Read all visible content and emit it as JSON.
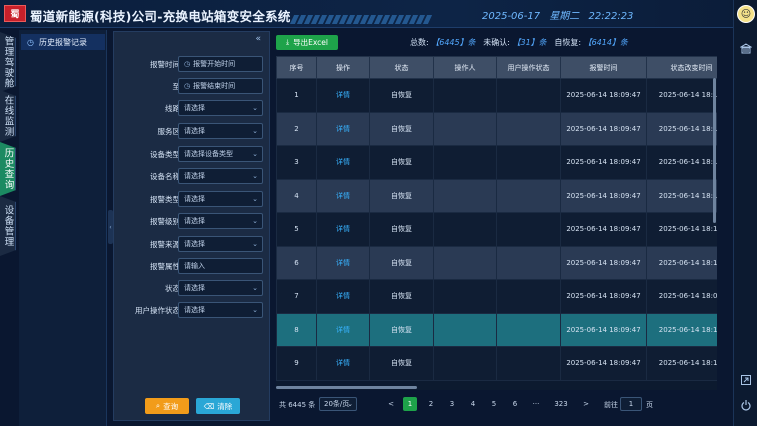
{
  "header": {
    "logo_text": "蜀",
    "title": "蜀道新能源(科技)公司-充换电站箱变安全系统",
    "date": "2025-06-17",
    "weekday": "星期二",
    "time": "22:22:23"
  },
  "vnav": {
    "items": [
      {
        "label": "管理驾驶舱"
      },
      {
        "label": "在线监测"
      },
      {
        "label": "历史查询"
      },
      {
        "label": "设备管理"
      }
    ]
  },
  "submenu": {
    "item": "历史报警记录"
  },
  "filter": {
    "collapse_icon": "«",
    "rows": [
      {
        "label": "报警时间",
        "value": "报警开始时间",
        "kind": "date"
      },
      {
        "label": "至",
        "value": "报警结束时间",
        "kind": "date"
      },
      {
        "label": "线路",
        "value": "请选择",
        "kind": "select"
      },
      {
        "label": "服务区",
        "value": "请选择",
        "kind": "select"
      },
      {
        "label": "设备类型",
        "value": "请选择设备类型",
        "kind": "select"
      },
      {
        "label": "设备名称",
        "value": "请选择",
        "kind": "select"
      },
      {
        "label": "报警类型",
        "value": "请选择",
        "kind": "select"
      },
      {
        "label": "报警级别",
        "value": "请选择",
        "kind": "select"
      },
      {
        "label": "报警来源",
        "value": "请选择",
        "kind": "select"
      },
      {
        "label": "报警属性",
        "value": "请输入",
        "kind": "text"
      },
      {
        "label": "状态",
        "value": "请选择",
        "kind": "select"
      },
      {
        "label": "用户操作状态",
        "value": "请选择",
        "kind": "select"
      }
    ],
    "query_label": "查询",
    "clear_label": "清除"
  },
  "toolbar": {
    "export_label": "导出Excel",
    "total_label": "总数:",
    "total_value": "【6445】条",
    "unconfirmed_label": "未确认:",
    "unconfirmed_value": "【31】条",
    "selfrecover_label": "自恢复:",
    "selfrecover_value": "【6414】条"
  },
  "table": {
    "columns": [
      "序号",
      "操作",
      "状态",
      "操作人",
      "用户操作状态",
      "报警时间",
      "状态改变时间"
    ],
    "rows": [
      {
        "no": "1",
        "op": "详情",
        "status": "自恢复",
        "operator": "",
        "user_status": "",
        "alarm_time": "2025-06-14 18:09:47",
        "change_time": "2025-06-14 18:10:"
      },
      {
        "no": "2",
        "op": "详情",
        "status": "自恢复",
        "operator": "",
        "user_status": "",
        "alarm_time": "2025-06-14 18:09:47",
        "change_time": "2025-06-14 18:10:"
      },
      {
        "no": "3",
        "op": "详情",
        "status": "自恢复",
        "operator": "",
        "user_status": "",
        "alarm_time": "2025-06-14 18:09:47",
        "change_time": "2025-06-14 18:11:"
      },
      {
        "no": "4",
        "op": "详情",
        "status": "自恢复",
        "operator": "",
        "user_status": "",
        "alarm_time": "2025-06-14 18:09:47",
        "change_time": "2025-06-14 18:10:"
      },
      {
        "no": "5",
        "op": "详情",
        "status": "自恢复",
        "operator": "",
        "user_status": "",
        "alarm_time": "2025-06-14 18:09:47",
        "change_time": "2025-06-14 18:10:"
      },
      {
        "no": "6",
        "op": "详情",
        "status": "自恢复",
        "operator": "",
        "user_status": "",
        "alarm_time": "2025-06-14 18:09:47",
        "change_time": "2025-06-14 18:10:"
      },
      {
        "no": "7",
        "op": "详情",
        "status": "自恢复",
        "operator": "",
        "user_status": "",
        "alarm_time": "2025-06-14 18:09:47",
        "change_time": "2025-06-14 18:09:"
      },
      {
        "no": "8",
        "op": "详情",
        "status": "自恢复",
        "operator": "",
        "user_status": "",
        "alarm_time": "2025-06-14 18:09:47",
        "change_time": "2025-06-14 18:11:"
      },
      {
        "no": "9",
        "op": "详情",
        "status": "自恢复",
        "operator": "",
        "user_status": "",
        "alarm_time": "2025-06-14 18:09:47",
        "change_time": "2025-06-14 18:10:"
      }
    ],
    "highlight_row": 8
  },
  "pager": {
    "total": "共 6445 条",
    "page_size": "20条/页",
    "prev": "<",
    "next": ">",
    "pages": [
      "1",
      "2",
      "3",
      "4",
      "5",
      "6",
      "···",
      "323"
    ],
    "goto_label": "前往",
    "goto_value": "1",
    "page_unit": "页"
  }
}
